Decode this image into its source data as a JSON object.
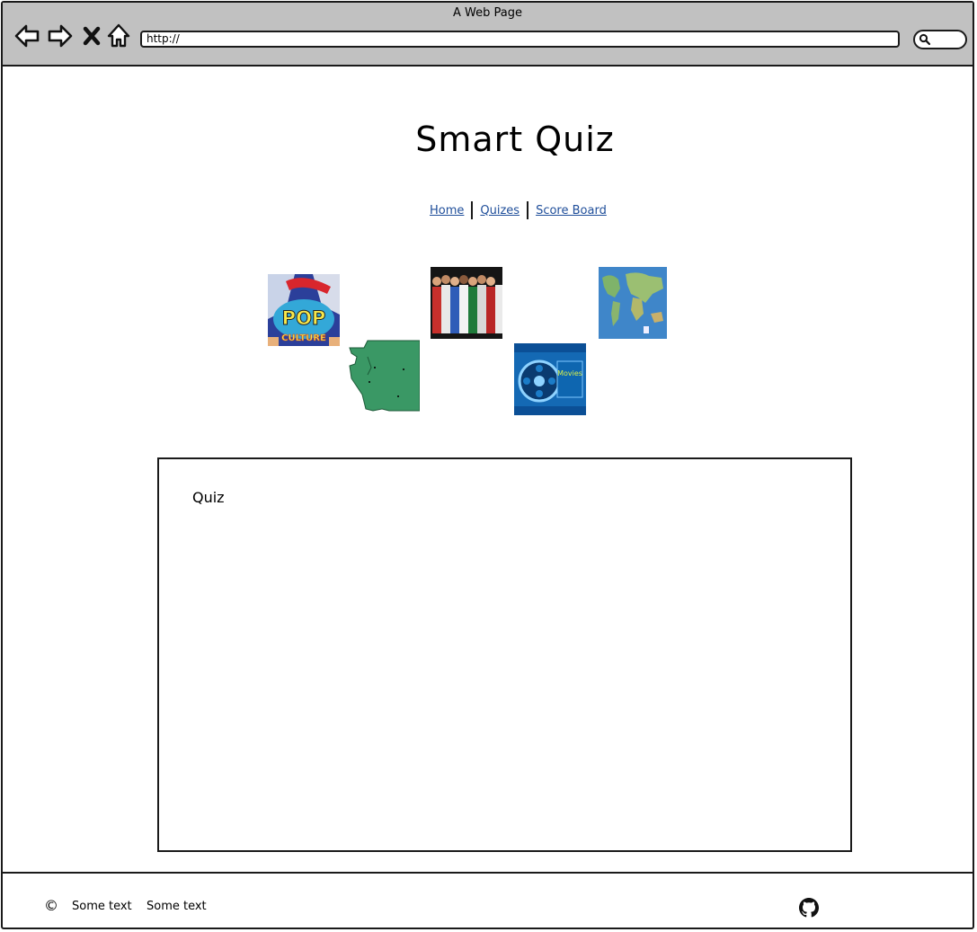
{
  "window": {
    "title": "A Web Page"
  },
  "toolbar": {
    "address_value": "http://",
    "icons": [
      "back-arrow-icon",
      "forward-arrow-icon",
      "stop-x-icon",
      "home-icon",
      "search-icon"
    ]
  },
  "page": {
    "title": "Smart Quiz",
    "nav": [
      {
        "label": "Home"
      },
      {
        "label": "Quizes"
      },
      {
        "label": "Score Board"
      }
    ],
    "thumbnails": [
      {
        "name": "pop-culture-image",
        "caption": "POP",
        "caption2": "CULTURE"
      },
      {
        "name": "washington-state-map-image"
      },
      {
        "name": "sports-team-image"
      },
      {
        "name": "movies-film-reel-image",
        "caption": "Movies"
      },
      {
        "name": "world-map-image"
      }
    ],
    "quiz_box": {
      "label": "Quiz"
    }
  },
  "footer": {
    "copyright_symbol": "©",
    "text1": "Some text",
    "text2": "Some text",
    "icon": "github-icon"
  },
  "colors": {
    "chrome": "#c1c1c1",
    "link": "#1f4e9a",
    "border": "#1a1a1a"
  }
}
